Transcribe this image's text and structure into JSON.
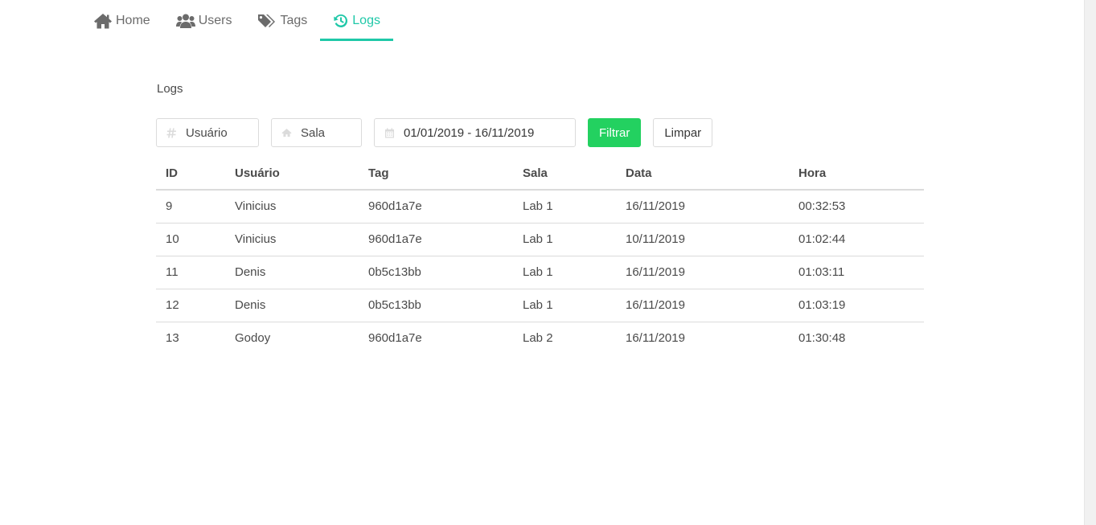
{
  "nav": {
    "tabs": [
      {
        "label": "Home",
        "icon": "home-icon",
        "active": false
      },
      {
        "label": "Users",
        "icon": "users-icon",
        "active": false
      },
      {
        "label": "Tags",
        "icon": "tags-icon",
        "active": false
      },
      {
        "label": "Logs",
        "icon": "history-icon",
        "active": true
      }
    ]
  },
  "page": {
    "title": "Logs"
  },
  "filters": {
    "user": {
      "placeholder": "Usuário",
      "value": "",
      "icon": "hash-icon"
    },
    "sala": {
      "placeholder": "Sala",
      "value": "",
      "icon": "home-icon"
    },
    "date": {
      "value": "01/01/2019 - 16/11/2019",
      "icon": "calendar-icon"
    },
    "filter_label": "Filtrar",
    "clear_label": "Limpar"
  },
  "table": {
    "headers": {
      "id": "ID",
      "user": "Usuário",
      "tag": "Tag",
      "sala": "Sala",
      "data": "Data",
      "hora": "Hora"
    },
    "rows": [
      {
        "id": "9",
        "user": "Vinicius",
        "tag": "960d1a7e",
        "sala": "Lab 1",
        "data": "16/11/2019",
        "hora": "00:32:53"
      },
      {
        "id": "10",
        "user": "Vinicius",
        "tag": "960d1a7e",
        "sala": "Lab 1",
        "data": "10/11/2019",
        "hora": "01:02:44"
      },
      {
        "id": "11",
        "user": "Denis",
        "tag": "0b5c13bb",
        "sala": "Lab 1",
        "data": "16/11/2019",
        "hora": "01:03:11"
      },
      {
        "id": "12",
        "user": "Denis",
        "tag": "0b5c13bb",
        "sala": "Lab 1",
        "data": "16/11/2019",
        "hora": "01:03:19"
      },
      {
        "id": "13",
        "user": "Godoy",
        "tag": "960d1a7e",
        "sala": "Lab 2",
        "data": "16/11/2019",
        "hora": "01:30:48"
      }
    ]
  },
  "colors": {
    "accent": "#1fc8a8",
    "primary_button": "#23d160",
    "border": "#dbdbdb",
    "text": "#4a4a4a"
  }
}
